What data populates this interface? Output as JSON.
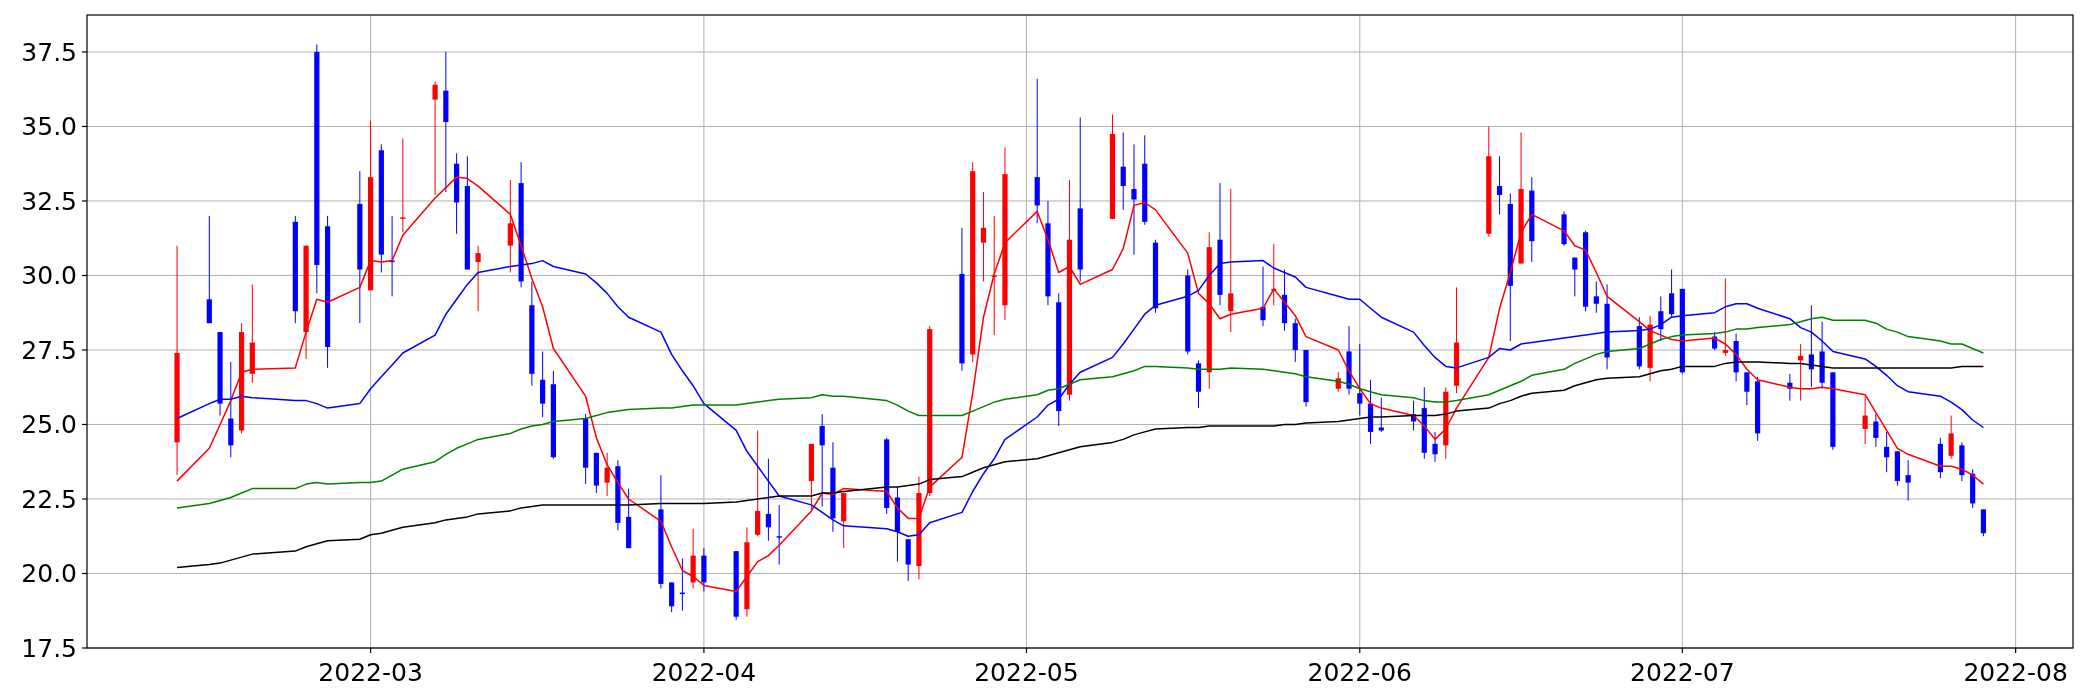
{
  "chart_data": {
    "type": "candlestick",
    "grid": true,
    "xlim": [
      "2022-02-02T15:00Z",
      "2022-08-06T08:00Z"
    ],
    "ylim": [
      17.5,
      38.74
    ],
    "xticks": [
      {
        "value": "2022-03-01",
        "label": "2022-03"
      },
      {
        "value": "2022-04-01",
        "label": "2022-04"
      },
      {
        "value": "2022-05-01",
        "label": "2022-05"
      },
      {
        "value": "2022-06-01",
        "label": "2022-06"
      },
      {
        "value": "2022-07-01",
        "label": "2022-07"
      },
      {
        "value": "2022-08-01",
        "label": "2022-08"
      }
    ],
    "yticks": [
      {
        "value": 17.5,
        "label": "17.5"
      },
      {
        "value": 20,
        "label": "20.0"
      },
      {
        "value": 22.5,
        "label": "22.5"
      },
      {
        "value": 25,
        "label": "25.0"
      },
      {
        "value": 27.5,
        "label": "27.5"
      },
      {
        "value": 30,
        "label": "30.0"
      },
      {
        "value": 32.5,
        "label": "32.5"
      },
      {
        "value": 35,
        "label": "35.0"
      },
      {
        "value": 37.5,
        "label": "37.5"
      }
    ],
    "x": [
      "2022-02-11",
      "2022-02-14",
      "2022-02-15",
      "2022-02-16",
      "2022-02-17",
      "2022-02-18",
      "2022-02-22",
      "2022-02-23",
      "2022-02-24",
      "2022-02-25",
      "2022-02-28",
      "2022-03-01",
      "2022-03-02",
      "2022-03-03",
      "2022-03-04",
      "2022-03-07",
      "2022-03-08",
      "2022-03-09",
      "2022-03-10",
      "2022-03-11",
      "2022-03-14",
      "2022-03-15",
      "2022-03-16",
      "2022-03-17",
      "2022-03-18",
      "2022-03-21",
      "2022-03-22",
      "2022-03-23",
      "2022-03-24",
      "2022-03-25",
      "2022-03-28",
      "2022-03-29",
      "2022-03-30",
      "2022-03-31",
      "2022-04-01",
      "2022-04-04",
      "2022-04-05",
      "2022-04-06",
      "2022-04-07",
      "2022-04-08",
      "2022-04-11",
      "2022-04-12",
      "2022-04-13",
      "2022-04-14",
      "2022-04-18",
      "2022-04-19",
      "2022-04-20",
      "2022-04-21",
      "2022-04-22",
      "2022-04-25",
      "2022-04-26",
      "2022-04-27",
      "2022-04-28",
      "2022-04-29",
      "2022-05-02",
      "2022-05-03",
      "2022-05-04",
      "2022-05-05",
      "2022-05-06",
      "2022-05-09",
      "2022-05-10",
      "2022-05-11",
      "2022-05-12",
      "2022-05-13",
      "2022-05-16",
      "2022-05-17",
      "2022-05-18",
      "2022-05-19",
      "2022-05-20",
      "2022-05-23",
      "2022-05-24",
      "2022-05-25",
      "2022-05-26",
      "2022-05-27",
      "2022-05-30",
      "2022-05-31",
      "2022-06-01",
      "2022-06-02",
      "2022-06-03",
      "2022-06-06",
      "2022-06-07",
      "2022-06-08",
      "2022-06-09",
      "2022-06-10",
      "2022-06-13",
      "2022-06-14",
      "2022-06-15",
      "2022-06-16",
      "2022-06-17",
      "2022-06-20",
      "2022-06-21",
      "2022-06-22",
      "2022-06-23",
      "2022-06-24",
      "2022-06-27",
      "2022-06-28",
      "2022-06-29",
      "2022-06-30",
      "2022-07-01",
      "2022-07-04",
      "2022-07-05",
      "2022-07-06",
      "2022-07-07",
      "2022-07-08",
      "2022-07-11",
      "2022-07-12",
      "2022-07-13",
      "2022-07-14",
      "2022-07-15",
      "2022-07-18",
      "2022-07-19",
      "2022-07-20",
      "2022-07-21",
      "2022-07-22",
      "2022-07-25",
      "2022-07-26",
      "2022-07-27",
      "2022-07-28",
      "2022-07-29"
    ],
    "ohlc": [
      [
        24.4,
        31.0,
        23.3,
        27.4
      ],
      [
        29.2,
        32.0,
        28.4,
        28.4
      ],
      [
        28.1,
        28.1,
        25.3,
        25.7
      ],
      [
        25.2,
        27.1,
        23.9,
        24.3
      ],
      [
        24.8,
        28.4,
        24.7,
        28.1
      ],
      [
        26.7,
        29.7,
        26.4,
        27.75
      ],
      [
        31.8,
        32.0,
        28.4,
        28.8
      ],
      [
        28.1,
        31.0,
        27.2,
        31.0
      ],
      [
        37.5,
        37.75,
        29.4,
        30.35
      ],
      [
        31.65,
        32.0,
        26.9,
        27.6
      ],
      [
        32.4,
        33.5,
        28.4,
        30.2
      ],
      [
        29.5,
        35.2,
        29.5,
        33.3
      ],
      [
        34.2,
        34.4,
        30.1,
        30.7
      ],
      [
        30.5,
        32.0,
        29.3,
        30.45
      ],
      [
        31.9,
        34.6,
        31.45,
        31.95
      ],
      [
        35.9,
        36.5,
        32.7,
        36.4
      ],
      [
        36.2,
        37.5,
        32.8,
        35.15
      ],
      [
        33.75,
        34.1,
        31.4,
        32.45
      ],
      [
        33.0,
        34.0,
        30.2,
        30.2
      ],
      [
        30.45,
        31.0,
        28.8,
        30.75
      ],
      [
        31.0,
        33.2,
        30.1,
        31.75
      ],
      [
        33.1,
        33.8,
        29.6,
        29.8
      ],
      [
        29.0,
        29.8,
        26.3,
        26.7
      ],
      [
        26.5,
        27.45,
        25.25,
        25.7
      ],
      [
        26.35,
        26.8,
        23.85,
        23.9
      ],
      [
        25.2,
        25.35,
        23.0,
        23.55
      ],
      [
        24.05,
        24.05,
        22.7,
        22.95
      ],
      [
        23.05,
        24.05,
        22.6,
        23.55
      ],
      [
        23.6,
        23.8,
        21.45,
        21.7
      ],
      [
        21.9,
        22.85,
        20.85,
        20.85
      ],
      [
        22.15,
        23.3,
        19.5,
        19.65
      ],
      [
        19.7,
        19.7,
        18.7,
        18.9
      ],
      [
        19.36,
        20.5,
        18.75,
        19.33
      ],
      [
        19.7,
        21.5,
        19.5,
        20.6
      ],
      [
        20.6,
        20.85,
        19.4,
        19.7
      ],
      [
        20.75,
        20.75,
        18.45,
        18.55
      ],
      [
        18.8,
        21.55,
        18.55,
        21.05
      ],
      [
        21.3,
        24.8,
        21.25,
        22.1
      ],
      [
        22.0,
        23.85,
        21.1,
        21.55
      ],
      [
        21.25,
        22.3,
        20.3,
        21.2
      ],
      [
        23.1,
        24.35,
        22.15,
        24.35
      ],
      [
        24.95,
        25.35,
        22.25,
        24.3
      ],
      [
        23.55,
        24.4,
        21.4,
        21.85
      ],
      [
        21.75,
        22.7,
        20.85,
        22.7
      ],
      [
        24.5,
        24.55,
        22.0,
        22.2
      ],
      [
        22.55,
        22.9,
        20.4,
        21.4
      ],
      [
        21.15,
        21.15,
        19.75,
        20.3
      ],
      [
        20.25,
        23.25,
        19.8,
        22.7
      ],
      [
        22.7,
        28.3,
        22.6,
        28.2
      ],
      [
        30.05,
        31.6,
        26.8,
        27.05
      ],
      [
        27.35,
        33.8,
        27.1,
        33.5
      ],
      [
        31.1,
        32.8,
        29.8,
        31.6
      ],
      [
        29.95,
        32.0,
        28.0,
        30.0
      ],
      [
        29.0,
        34.3,
        28.5,
        33.4
      ],
      [
        33.3,
        36.6,
        31.75,
        32.35
      ],
      [
        31.75,
        32.5,
        29.0,
        29.3
      ],
      [
        29.1,
        29.4,
        24.95,
        25.45
      ],
      [
        26.0,
        33.2,
        25.8,
        31.2
      ],
      [
        32.25,
        35.3,
        29.8,
        30.2
      ],
      [
        31.9,
        35.4,
        31.9,
        34.75
      ],
      [
        33.65,
        34.8,
        32.2,
        33.0
      ],
      [
        32.9,
        34.4,
        30.7,
        32.55
      ],
      [
        33.75,
        34.7,
        31.7,
        31.8
      ],
      [
        31.1,
        31.2,
        28.75,
        28.9
      ],
      [
        30.0,
        30.2,
        27.35,
        27.45
      ],
      [
        27.05,
        27.15,
        25.55,
        26.1
      ],
      [
        26.75,
        31.45,
        26.2,
        30.95
      ],
      [
        31.2,
        33.1,
        29.0,
        29.35
      ],
      [
        28.8,
        32.9,
        28.1,
        29.4
      ],
      [
        28.95,
        30.3,
        28.3,
        28.5
      ],
      [
        29.5,
        31.05,
        29.0,
        29.55
      ],
      [
        29.35,
        30.2,
        28.15,
        28.4
      ],
      [
        28.4,
        28.55,
        27.1,
        27.5
      ],
      [
        27.5,
        27.5,
        25.6,
        25.75
      ],
      [
        26.2,
        26.75,
        26.1,
        26.55
      ],
      [
        27.45,
        28.3,
        26.0,
        26.2
      ],
      [
        26.05,
        27.7,
        25.3,
        25.7
      ],
      [
        25.7,
        26.5,
        24.35,
        24.75
      ],
      [
        24.9,
        25.9,
        24.75,
        24.8
      ],
      [
        25.35,
        25.8,
        24.8,
        25.1
      ],
      [
        25.55,
        26.25,
        23.85,
        24.05
      ],
      [
        24.35,
        24.75,
        23.75,
        24.0
      ],
      [
        24.3,
        26.25,
        23.85,
        26.1
      ],
      [
        26.3,
        29.6,
        26.05,
        27.75
      ],
      [
        31.4,
        35.0,
        31.3,
        34.0
      ],
      [
        33.0,
        34.0,
        32.05,
        32.7
      ],
      [
        32.4,
        32.75,
        27.8,
        29.65
      ],
      [
        30.4,
        34.8,
        30.4,
        32.9
      ],
      [
        32.85,
        33.3,
        30.45,
        31.15
      ],
      [
        32.05,
        32.15,
        31.0,
        31.05
      ],
      [
        30.6,
        30.6,
        29.3,
        30.2
      ],
      [
        31.45,
        31.5,
        28.8,
        28.95
      ],
      [
        29.3,
        29.8,
        28.75,
        29.05
      ],
      [
        29.05,
        29.7,
        26.85,
        27.25
      ],
      [
        28.3,
        28.6,
        26.85,
        26.95
      ],
      [
        26.9,
        28.65,
        26.45,
        28.35
      ],
      [
        28.8,
        29.3,
        27.8,
        28.2
      ],
      [
        29.4,
        30.2,
        28.6,
        28.7
      ],
      [
        29.55,
        29.55,
        26.7,
        26.75
      ],
      [
        27.95,
        28.1,
        27.5,
        27.55
      ],
      [
        27.4,
        29.9,
        27.3,
        27.5
      ],
      [
        27.8,
        28.05,
        26.45,
        26.75
      ],
      [
        26.75,
        26.75,
        25.65,
        26.1
      ],
      [
        26.45,
        26.6,
        24.45,
        24.7
      ],
      [
        26.4,
        26.7,
        25.8,
        26.2
      ],
      [
        27.15,
        27.7,
        25.8,
        27.3
      ],
      [
        27.35,
        29.0,
        26.25,
        26.85
      ],
      [
        27.45,
        28.45,
        26.2,
        26.4
      ],
      [
        26.75,
        26.75,
        24.15,
        24.25
      ],
      [
        24.85,
        25.95,
        24.35,
        25.3
      ],
      [
        25.1,
        25.35,
        24.25,
        24.55
      ],
      [
        24.25,
        24.75,
        23.4,
        23.9
      ],
      [
        24.1,
        24.1,
        22.95,
        23.1
      ],
      [
        23.3,
        23.8,
        22.45,
        23.05
      ],
      [
        24.35,
        24.55,
        23.2,
        23.4
      ],
      [
        23.95,
        25.3,
        23.85,
        24.7
      ],
      [
        24.3,
        24.4,
        23.1,
        23.3
      ],
      [
        23.35,
        23.5,
        22.2,
        22.35
      ],
      [
        22.15,
        22.15,
        21.25,
        21.35
      ]
    ],
    "series": [
      {
        "type": "line",
        "color": "#ff0000",
        "values": [
          23.1,
          24.2,
          25.0,
          25.8,
          26.75,
          26.85,
          26.9,
          28.1,
          29.2,
          29.1,
          29.6,
          30.5,
          30.45,
          30.5,
          31.35,
          32.6,
          32.95,
          33.3,
          33.25,
          33.0,
          32.05,
          31.0,
          29.9,
          28.95,
          27.55,
          25.95,
          24.55,
          23.65,
          23.05,
          22.5,
          21.75,
          20.9,
          20.1,
          19.9,
          19.6,
          19.4,
          19.9,
          20.4,
          20.6,
          20.95,
          22.1,
          22.7,
          22.65,
          22.85,
          22.75,
          22.2,
          21.85,
          21.85,
          22.9,
          23.9,
          26.05,
          28.6,
          30.05,
          31.1,
          32.15,
          31.2,
          30.1,
          30.3,
          29.7,
          30.2,
          30.9,
          32.35,
          32.45,
          32.2,
          30.75,
          29.4,
          29.05,
          28.55,
          28.7,
          28.9,
          29.55,
          29.1,
          28.65,
          27.95,
          27.5,
          26.8,
          26.2,
          25.7,
          25.55,
          25.3,
          24.95,
          24.5,
          24.85,
          25.55,
          27.25,
          28.9,
          30.1,
          31.45,
          32.05,
          31.5,
          31.0,
          30.85,
          30.1,
          29.3,
          28.45,
          28.15,
          28.0,
          27.85,
          27.8,
          27.9,
          27.7,
          27.35,
          26.85,
          26.5,
          26.25,
          26.2,
          26.2,
          26.25,
          26.2,
          26.0,
          25.4,
          24.8,
          24.2,
          24.0,
          23.6,
          23.6,
          23.5,
          23.3,
          23.0
        ]
      },
      {
        "type": "line",
        "color": "#0000ff",
        "values": [
          25.2,
          25.7,
          25.85,
          25.85,
          25.95,
          25.9,
          25.8,
          25.8,
          25.7,
          25.55,
          25.7,
          26.2,
          26.6,
          27.0,
          27.4,
          28.0,
          28.7,
          29.2,
          29.7,
          30.1,
          30.3,
          30.35,
          30.4,
          30.5,
          30.3,
          30.05,
          29.75,
          29.4,
          28.95,
          28.6,
          28.1,
          27.35,
          26.8,
          26.3,
          25.7,
          24.8,
          24.1,
          23.6,
          23.1,
          22.6,
          22.3,
          22.05,
          21.8,
          21.6,
          21.5,
          21.4,
          21.25,
          21.3,
          21.7,
          22.05,
          22.75,
          23.35,
          23.85,
          24.5,
          25.25,
          25.65,
          25.85,
          26.35,
          26.75,
          27.25,
          27.7,
          28.2,
          28.7,
          29.0,
          29.3,
          29.5,
          30.0,
          30.4,
          30.45,
          30.5,
          30.25,
          30.1,
          29.95,
          29.6,
          29.3,
          29.2,
          29.2,
          28.9,
          28.6,
          28.1,
          27.65,
          27.25,
          26.95,
          26.9,
          27.25,
          27.55,
          27.5,
          27.7,
          27.75,
          27.9,
          27.95,
          28.0,
          28.05,
          28.1,
          28.15,
          28.2,
          28.35,
          28.6,
          28.65,
          28.75,
          28.95,
          29.05,
          29.05,
          28.9,
          28.55,
          28.25,
          28.1,
          27.8,
          27.45,
          27.2,
          26.95,
          26.65,
          26.3,
          26.1,
          25.95,
          25.75,
          25.5,
          25.15,
          24.9
        ]
      },
      {
        "type": "line",
        "color": "#008000",
        "values": [
          22.2,
          22.35,
          22.45,
          22.55,
          22.7,
          22.85,
          22.85,
          23.0,
          23.05,
          23.0,
          23.05,
          23.05,
          23.1,
          23.3,
          23.5,
          23.75,
          24.0,
          24.2,
          24.35,
          24.5,
          24.7,
          24.85,
          24.95,
          25.0,
          25.1,
          25.2,
          25.3,
          25.4,
          25.45,
          25.5,
          25.55,
          25.55,
          25.6,
          25.65,
          25.65,
          25.65,
          25.7,
          25.75,
          25.8,
          25.85,
          25.9,
          26.0,
          25.95,
          25.95,
          25.8,
          25.65,
          25.45,
          25.3,
          25.3,
          25.3,
          25.45,
          25.6,
          25.75,
          25.85,
          26.0,
          26.15,
          26.2,
          26.35,
          26.5,
          26.6,
          26.7,
          26.8,
          26.95,
          26.95,
          26.9,
          26.85,
          26.85,
          26.85,
          26.9,
          26.85,
          26.8,
          26.75,
          26.7,
          26.6,
          26.45,
          26.35,
          26.2,
          26.1,
          26.0,
          25.9,
          25.8,
          25.75,
          25.75,
          25.8,
          26.0,
          26.15,
          26.3,
          26.45,
          26.65,
          26.85,
          27.05,
          27.2,
          27.35,
          27.45,
          27.55,
          27.7,
          27.85,
          27.95,
          28.0,
          28.05,
          28.1,
          28.2,
          28.2,
          28.25,
          28.35,
          28.45,
          28.55,
          28.6,
          28.5,
          28.5,
          28.4,
          28.2,
          28.1,
          27.95,
          27.8,
          27.7,
          27.7,
          27.55,
          27.4
        ]
      },
      {
        "type": "line",
        "color": "#000000",
        "values": [
          20.2,
          20.3,
          20.35,
          20.45,
          20.55,
          20.65,
          20.75,
          20.9,
          21.0,
          21.1,
          21.15,
          21.3,
          21.35,
          21.45,
          21.55,
          21.7,
          21.8,
          21.85,
          21.9,
          22.0,
          22.1,
          22.2,
          22.25,
          22.3,
          22.3,
          22.3,
          22.3,
          22.3,
          22.3,
          22.3,
          22.35,
          22.35,
          22.35,
          22.35,
          22.35,
          22.4,
          22.45,
          22.5,
          22.55,
          22.6,
          22.6,
          22.7,
          22.7,
          22.75,
          22.9,
          22.9,
          22.95,
          23.0,
          23.15,
          23.25,
          23.4,
          23.55,
          23.65,
          23.75,
          23.85,
          23.95,
          24.05,
          24.15,
          24.25,
          24.4,
          24.5,
          24.65,
          24.75,
          24.85,
          24.9,
          24.9,
          24.95,
          24.95,
          24.95,
          24.95,
          24.95,
          25.0,
          25.0,
          25.05,
          25.1,
          25.15,
          25.2,
          25.25,
          25.25,
          25.3,
          25.3,
          25.3,
          25.35,
          25.45,
          25.55,
          25.7,
          25.8,
          25.95,
          26.05,
          26.15,
          26.3,
          26.4,
          26.5,
          26.55,
          26.6,
          26.7,
          26.8,
          26.85,
          26.95,
          26.95,
          27.05,
          27.1,
          27.1,
          27.1,
          27.05,
          27.05,
          27.0,
          26.95,
          26.9,
          26.9,
          26.9,
          26.9,
          26.9,
          26.9,
          26.9,
          26.9,
          26.95,
          26.95,
          26.95
        ]
      }
    ]
  }
}
